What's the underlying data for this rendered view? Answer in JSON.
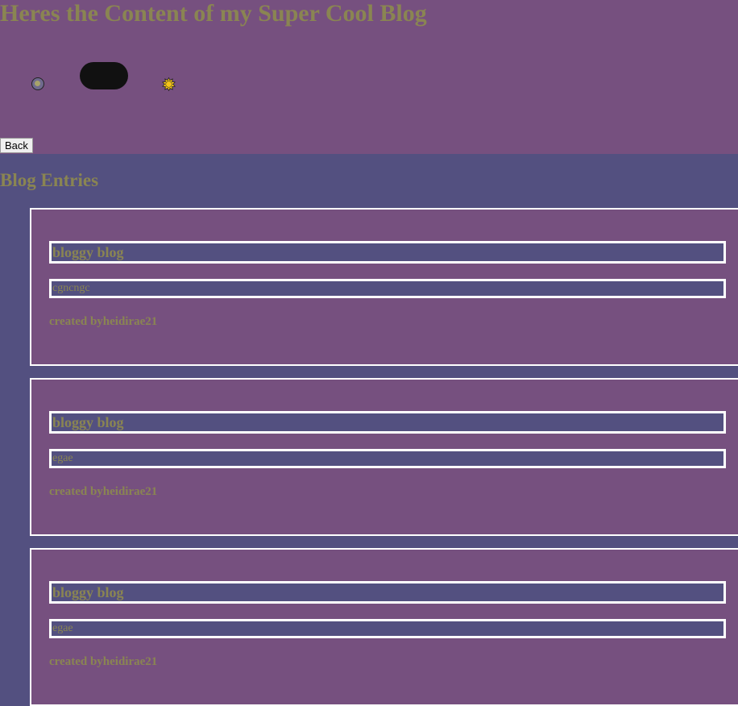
{
  "header": {
    "title": "Heres the Content of my Super Cool Blog",
    "back_label": "Back",
    "icons": {
      "left": "moon-icon",
      "toggle": "theme-toggle",
      "right": "sun-icon"
    },
    "colors": {
      "header_bg": "#76507f",
      "page_bg": "#535080",
      "text": "#8a8552",
      "toggle": "#111111",
      "sun": "#f5c518"
    }
  },
  "blog": {
    "section_title": "Blog Entries",
    "entries": [
      {
        "title": "bloggy blog",
        "body": "cgncngc",
        "author": "created byheidirae21"
      },
      {
        "title": "bloggy blog",
        "body": "egae",
        "author": "created byheidirae21"
      },
      {
        "title": "bloggy blog",
        "body": "egae",
        "author": "created byheidirae21"
      }
    ]
  }
}
